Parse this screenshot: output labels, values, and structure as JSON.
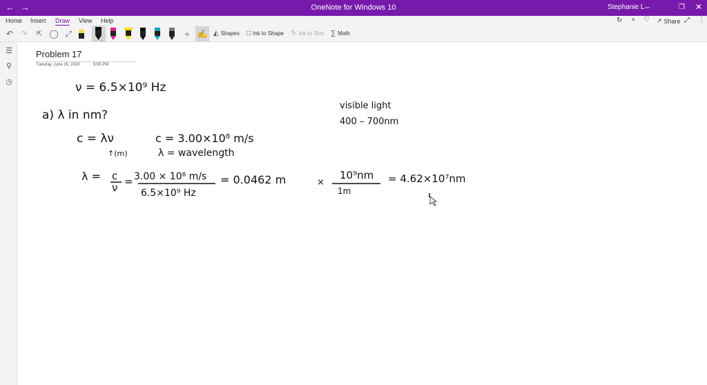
{
  "titlebar": {
    "back_icon": "arrow-left-icon",
    "forward_icon": "arrow-right-icon",
    "app_title": "OneNote for Windows 10",
    "user_name": "Stephanie L",
    "window_buttons": [
      "minimize-icon",
      "restore-icon",
      "close-icon"
    ],
    "accent_color": "#7719aa"
  },
  "menu": {
    "tabs": [
      {
        "label": "Home"
      },
      {
        "label": "Insert"
      },
      {
        "label": "Draw",
        "active": true
      },
      {
        "label": "View"
      },
      {
        "label": "Help"
      }
    ],
    "right_actions": {
      "share_label": "Share"
    }
  },
  "toolbar": {
    "pens": [
      {
        "icon": "highlighter-yellow-icon",
        "color": "#f0e04a"
      },
      {
        "icon": "pen-black-icon",
        "color": "#111111",
        "selected": true
      },
      {
        "icon": "pen-magenta-icon",
        "color": "#e01e8c"
      },
      {
        "icon": "highlighter-yellow-icon",
        "color": "#f5e11a"
      },
      {
        "icon": "pen-black-icon",
        "color": "#111111"
      },
      {
        "icon": "pen-teal-icon",
        "color": "#1aa3b8"
      },
      {
        "icon": "pen-pattern-icon",
        "color": "#333333"
      }
    ],
    "shapes_label": "Shapes",
    "ink_to_shape_label": "Ink to Shape",
    "ink_to_text_label": "Ink to Text",
    "math_label": "Math"
  },
  "page": {
    "title": "Problem 17",
    "date": "Tuesday, June 30, 2020",
    "time": "9:05 PM"
  },
  "handwriting": {
    "given": "ν = 6.5×10⁹ Hz",
    "question": "a) λ in nm?",
    "visible_light": "visible light",
    "visible_range": "400 – 700nm",
    "formula": "c = λν",
    "lambda_unit_note": "↑(m)",
    "speed_of_light": "c = 3.00×10⁸ m/s",
    "lambda_def": "λ = wavelength",
    "calc_lambda": "λ =",
    "calc_c": "c",
    "calc_nu": "ν",
    "calc_equals_1": "=",
    "calc_numerator": "3.00 × 10⁸ m/s",
    "calc_denominator": "6.5×10⁹ Hz",
    "calc_result_m": "= 0.0462 m",
    "calc_times": "×",
    "calc_conv_num": "10⁹nm",
    "calc_conv_den": "1m",
    "calc_final": "= 4.62×10⁷nm"
  }
}
